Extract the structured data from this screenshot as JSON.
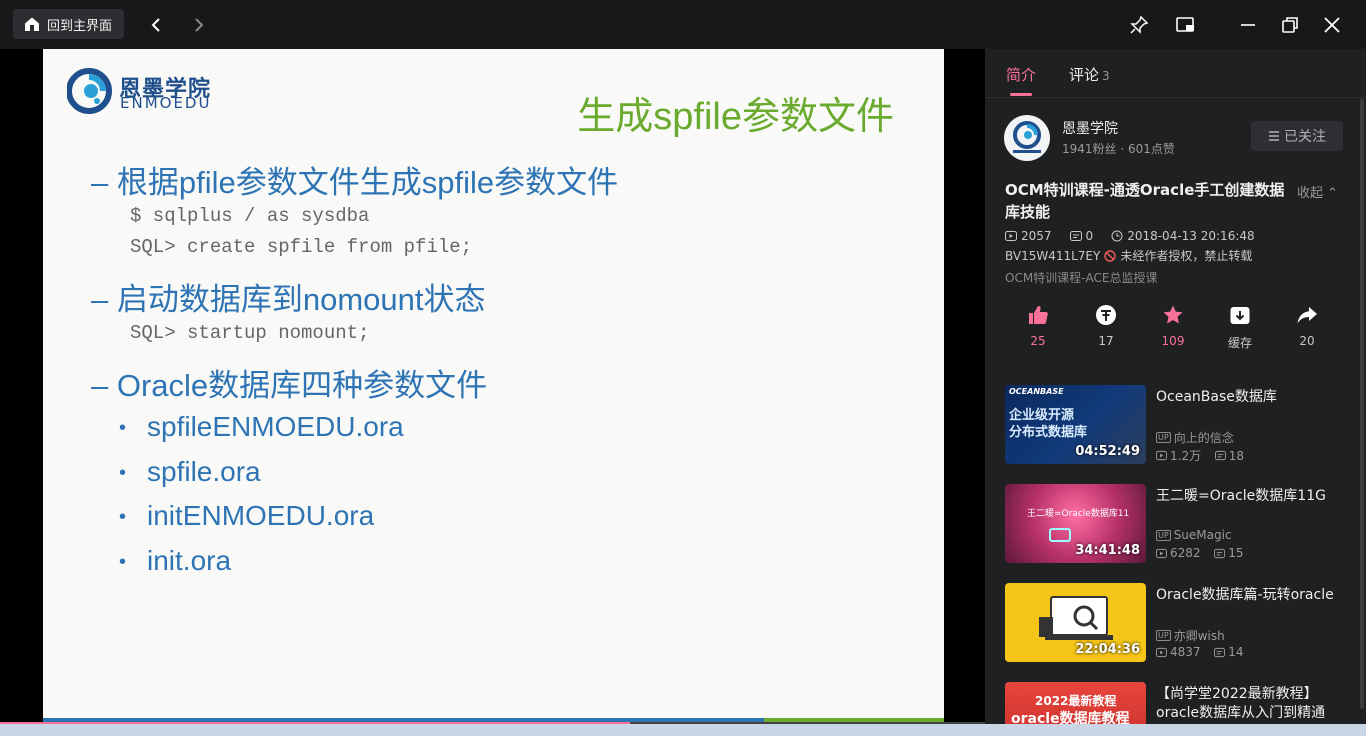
{
  "topbar": {
    "home_label": "回到主界面"
  },
  "slide": {
    "logo_cn": "恩墨学院",
    "logo_en": "ENMOEDU",
    "title": "生成spfile参数文件",
    "items": [
      {
        "text": "– 根据pfile参数文件生成spfile参数文件"
      },
      {
        "text": "– 启动数据库到nomount状态"
      },
      {
        "text": "– Oracle数据库四种参数文件"
      }
    ],
    "code_lines": [
      "$ sqlplus / as sysdba",
      "SQL> create spfile from pfile;",
      "SQL> startup nomount;"
    ],
    "sub_items": [
      "spfileENMOEDU.ora",
      "spfile.ora",
      "initENMOEDU.ora",
      "init.ora"
    ],
    "bullet_glyph": "•"
  },
  "player": {
    "progress_fraction": 0.64
  },
  "panel": {
    "tab_intro": "简介",
    "tab_comments": "评论",
    "comments_count": "3",
    "uploader": {
      "name": "恩墨学院",
      "stats": "1941粉丝 · 601点赞",
      "follow_label": "已关注"
    },
    "video": {
      "title": "OCM特训课程-通透Oracle手工创建数据库技能",
      "collapse_label": "收起",
      "views": "2057",
      "danmaku": "0",
      "datetime": "2018-04-13 20:16:48",
      "bvid": "BV15W411L7EY",
      "copyright": "未经作者授权，禁止转载",
      "collection": "OCM特训课程-ACE总监授课"
    },
    "actions": {
      "like": "25",
      "coin": "17",
      "favorite": "109",
      "cache": "缓存",
      "share": "20"
    },
    "recommendations": [
      {
        "title": "OceanBase数据库",
        "uploader": "向上的信念",
        "views": "1.2万",
        "danmaku": "18",
        "duration": "04:52:49",
        "thumb_brand": "OCEANBASE",
        "thumb_line1": "企业级开源",
        "thumb_line2": "分布式数据库"
      },
      {
        "title": "王二暖=Oracle数据库11G",
        "uploader": "SueMagic",
        "views": "6282",
        "danmaku": "15",
        "duration": "34:41:48",
        "thumb_text": "王二暖=Oracle数据库11"
      },
      {
        "title": "Oracle数据库篇-玩转oracle",
        "uploader": "亦卿wish",
        "views": "4837",
        "danmaku": "14",
        "duration": "22:04:36"
      },
      {
        "title": "【尚学堂2022最新教程】oracle数据库从入门到精通",
        "thumb_line1": "2022最新教程",
        "thumb_line2": "oracle数据库教程"
      }
    ],
    "up_badge": "UP"
  },
  "colors": {
    "accent": "#fb7299",
    "slide_blue": "#2e74b5",
    "slide_green": "#6aaa2e"
  }
}
